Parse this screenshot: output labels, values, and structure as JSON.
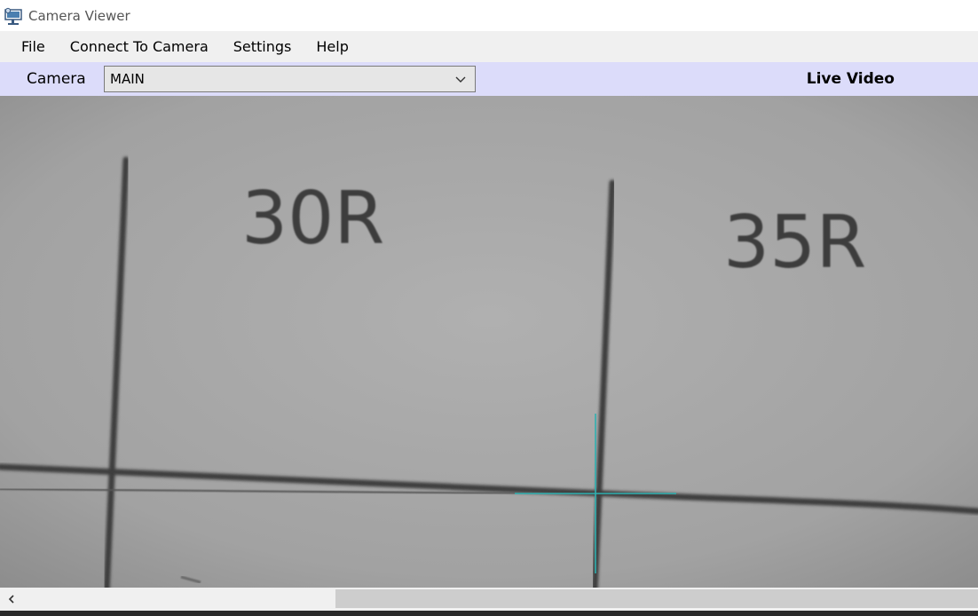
{
  "window": {
    "title": "Camera Viewer"
  },
  "menu": {
    "items": [
      "File",
      "Connect To Camera",
      "Settings",
      "Help"
    ]
  },
  "toolbar": {
    "camera_label": "Camera",
    "camera_value": "MAIN",
    "mode_label": "Live Video"
  },
  "video": {
    "labels": [
      "30R",
      "35R"
    ],
    "crosshair_color": "#2fb0b0"
  },
  "icons": {
    "app": "projector-icon",
    "dropdown": "chevron-down-icon",
    "scroll_left": "chevron-left-icon"
  }
}
